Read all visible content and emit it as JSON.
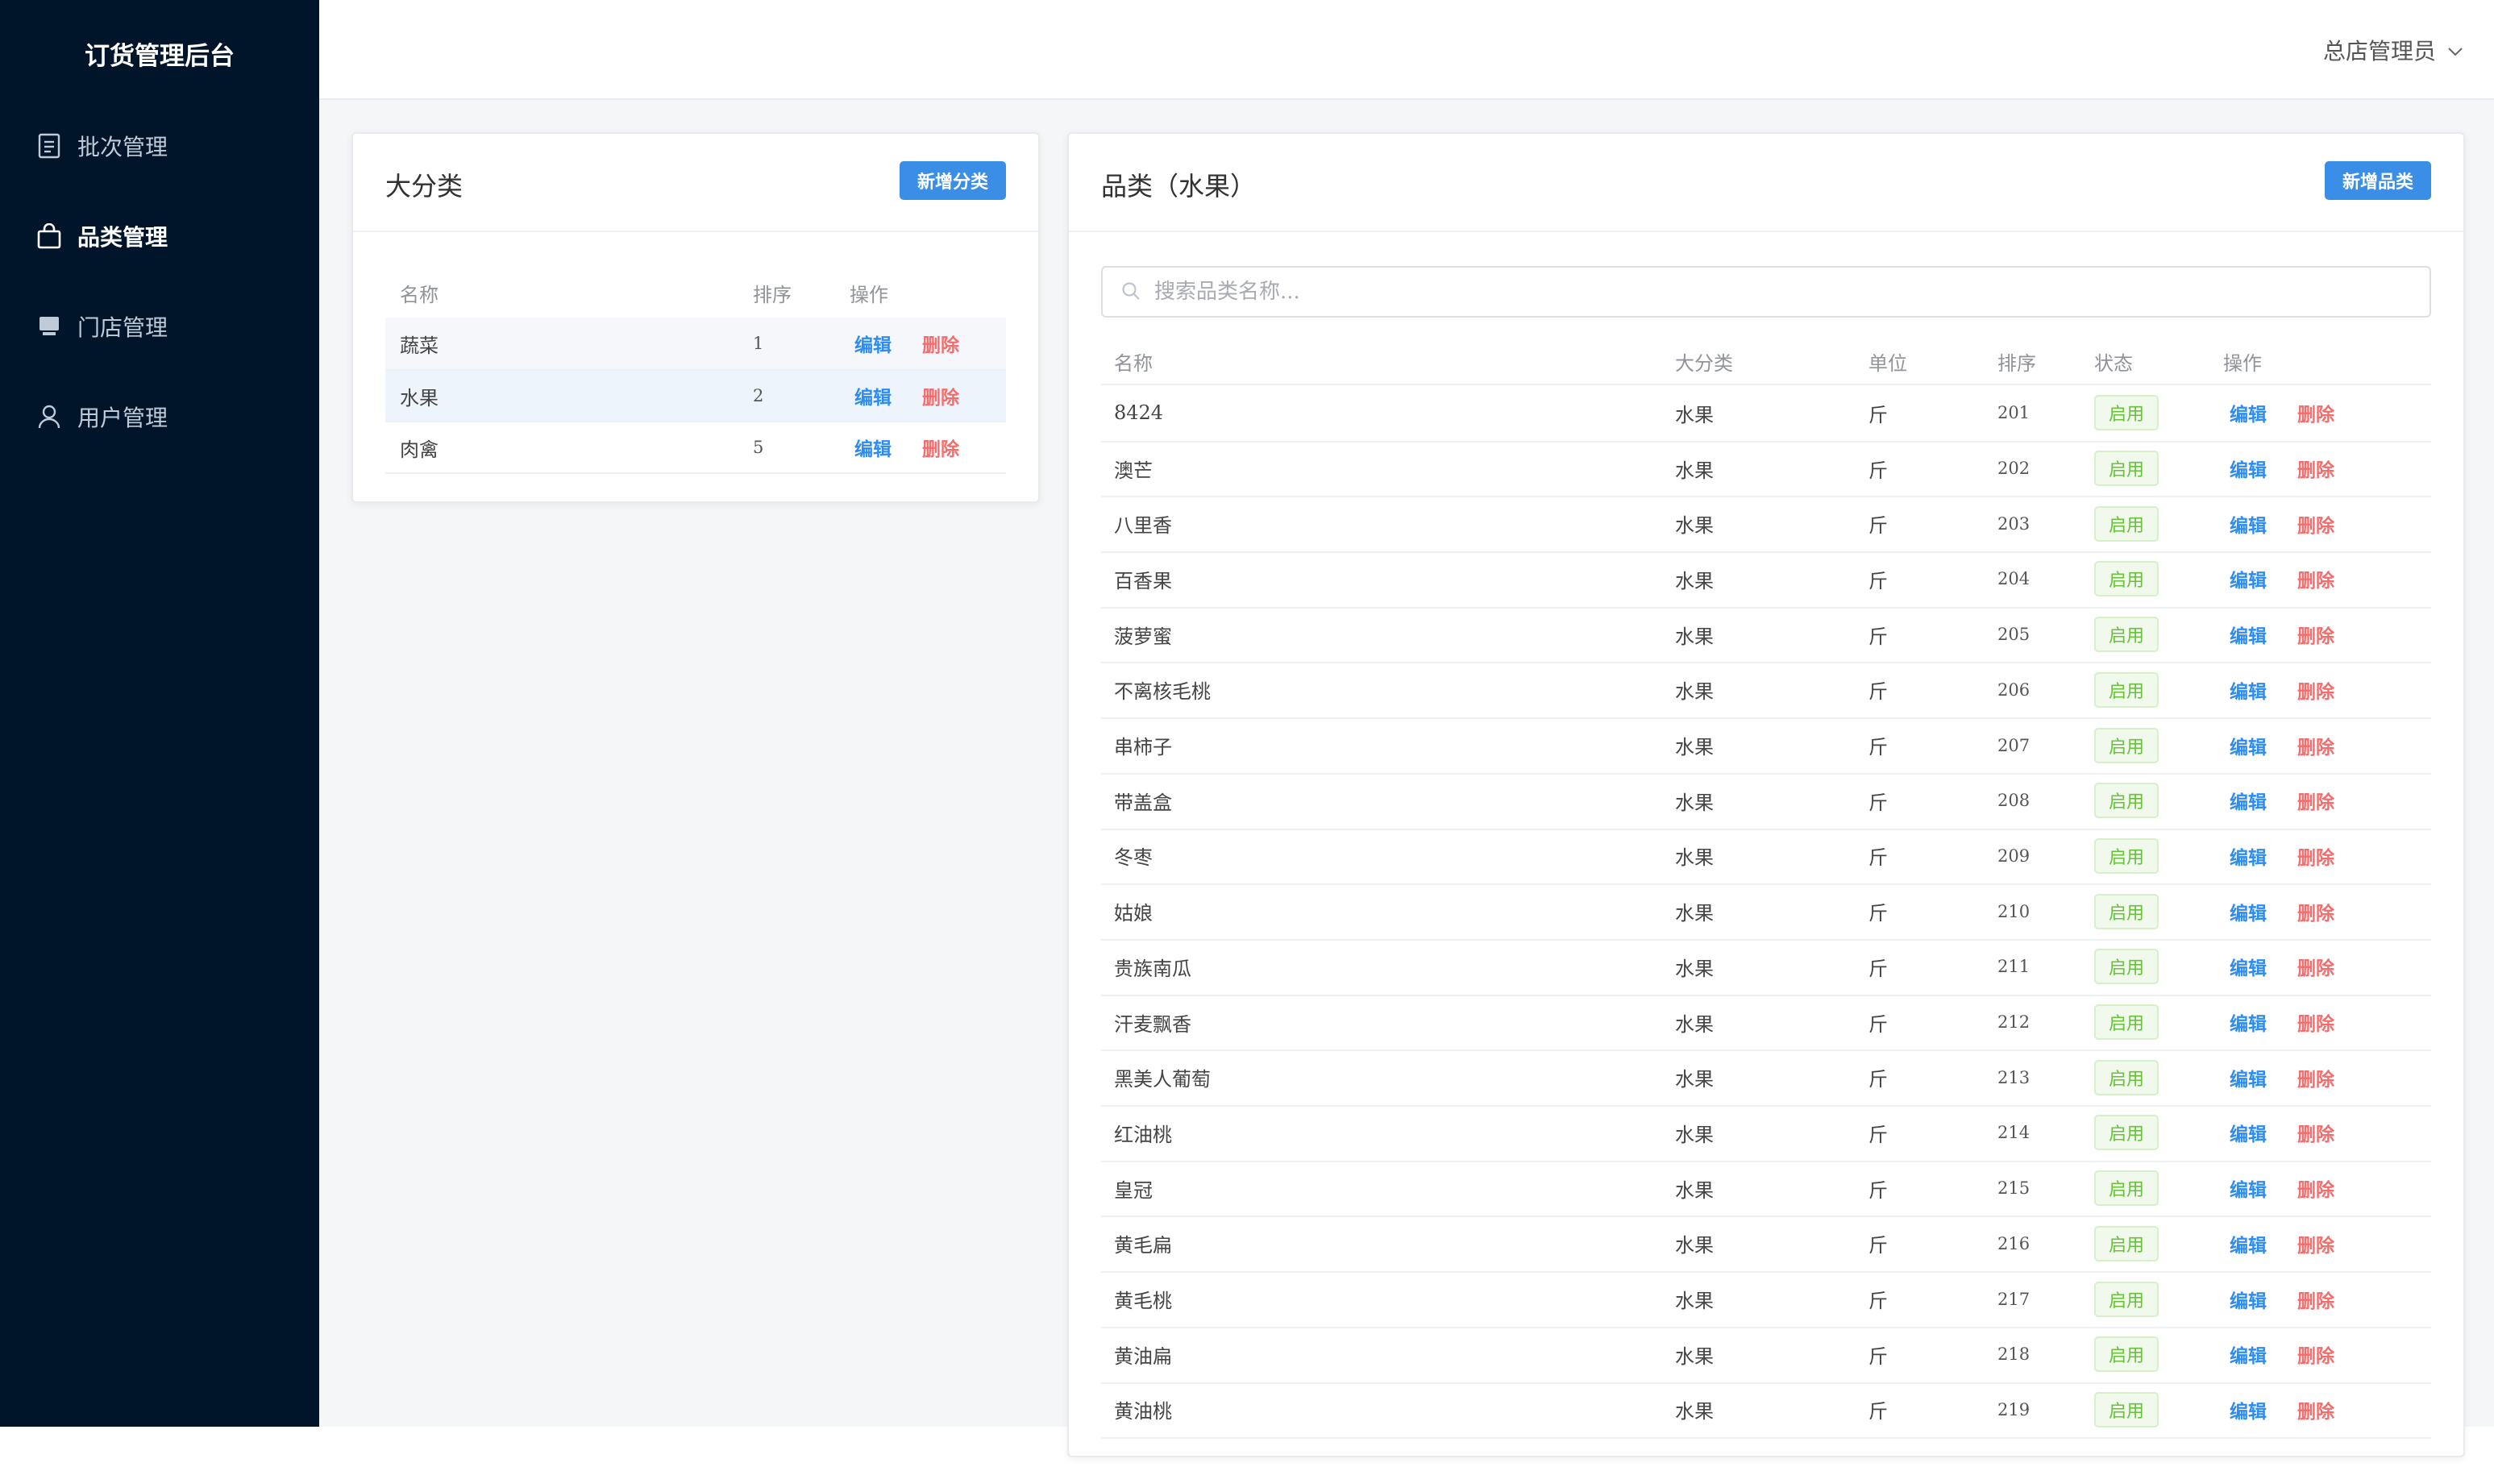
{
  "brand": "订货管理后台",
  "menu": [
    {
      "label": "批次管理",
      "icon": "document-icon",
      "active": false
    },
    {
      "label": "品类管理",
      "icon": "bag-icon",
      "active": true
    },
    {
      "label": "门店管理",
      "icon": "store-icon",
      "active": false
    },
    {
      "label": "用户管理",
      "icon": "user-icon",
      "active": false
    }
  ],
  "header": {
    "user": "总店管理员"
  },
  "categories": {
    "title": "大分类",
    "add_label": "新增分类",
    "columns": [
      "名称",
      "排序",
      "操作"
    ],
    "rows": [
      {
        "name": "蔬菜",
        "order": "1"
      },
      {
        "name": "水果",
        "order": "2",
        "selected": true
      },
      {
        "name": "肉禽",
        "order": "5"
      }
    ],
    "edit_label": "编辑",
    "delete_label": "删除"
  },
  "items": {
    "title": "品类（水果）",
    "add_label": "新增品类",
    "search_placeholder": "搜索品类名称...",
    "columns": [
      "名称",
      "大分类",
      "单位",
      "排序",
      "状态",
      "操作"
    ],
    "edit_label": "编辑",
    "delete_label": "删除",
    "rows": [
      {
        "name": "8424",
        "category": "水果",
        "unit": "斤",
        "order": "201",
        "status": "启用"
      },
      {
        "name": "澳芒",
        "category": "水果",
        "unit": "斤",
        "order": "202",
        "status": "启用"
      },
      {
        "name": "八里香",
        "category": "水果",
        "unit": "斤",
        "order": "203",
        "status": "启用"
      },
      {
        "name": "百香果",
        "category": "水果",
        "unit": "斤",
        "order": "204",
        "status": "启用"
      },
      {
        "name": "菠萝蜜",
        "category": "水果",
        "unit": "斤",
        "order": "205",
        "status": "启用"
      },
      {
        "name": "不离核毛桃",
        "category": "水果",
        "unit": "斤",
        "order": "206",
        "status": "启用"
      },
      {
        "name": "串柿子",
        "category": "水果",
        "unit": "斤",
        "order": "207",
        "status": "启用"
      },
      {
        "name": "带盖盒",
        "category": "水果",
        "unit": "斤",
        "order": "208",
        "status": "启用"
      },
      {
        "name": "冬枣",
        "category": "水果",
        "unit": "斤",
        "order": "209",
        "status": "启用"
      },
      {
        "name": "姑娘",
        "category": "水果",
        "unit": "斤",
        "order": "210",
        "status": "启用"
      },
      {
        "name": "贵族南瓜",
        "category": "水果",
        "unit": "斤",
        "order": "211",
        "status": "启用"
      },
      {
        "name": "汗麦飘香",
        "category": "水果",
        "unit": "斤",
        "order": "212",
        "status": "启用"
      },
      {
        "name": "黑美人葡萄",
        "category": "水果",
        "unit": "斤",
        "order": "213",
        "status": "启用"
      },
      {
        "name": "红油桃",
        "category": "水果",
        "unit": "斤",
        "order": "214",
        "status": "启用"
      },
      {
        "name": "皇冠",
        "category": "水果",
        "unit": "斤",
        "order": "215",
        "status": "启用"
      },
      {
        "name": "黄毛扁",
        "category": "水果",
        "unit": "斤",
        "order": "216",
        "status": "启用"
      },
      {
        "name": "黄毛桃",
        "category": "水果",
        "unit": "斤",
        "order": "217",
        "status": "启用"
      },
      {
        "name": "黄油扁",
        "category": "水果",
        "unit": "斤",
        "order": "218",
        "status": "启用"
      },
      {
        "name": "黄油桃",
        "category": "水果",
        "unit": "斤",
        "order": "219",
        "status": "启用"
      }
    ]
  }
}
